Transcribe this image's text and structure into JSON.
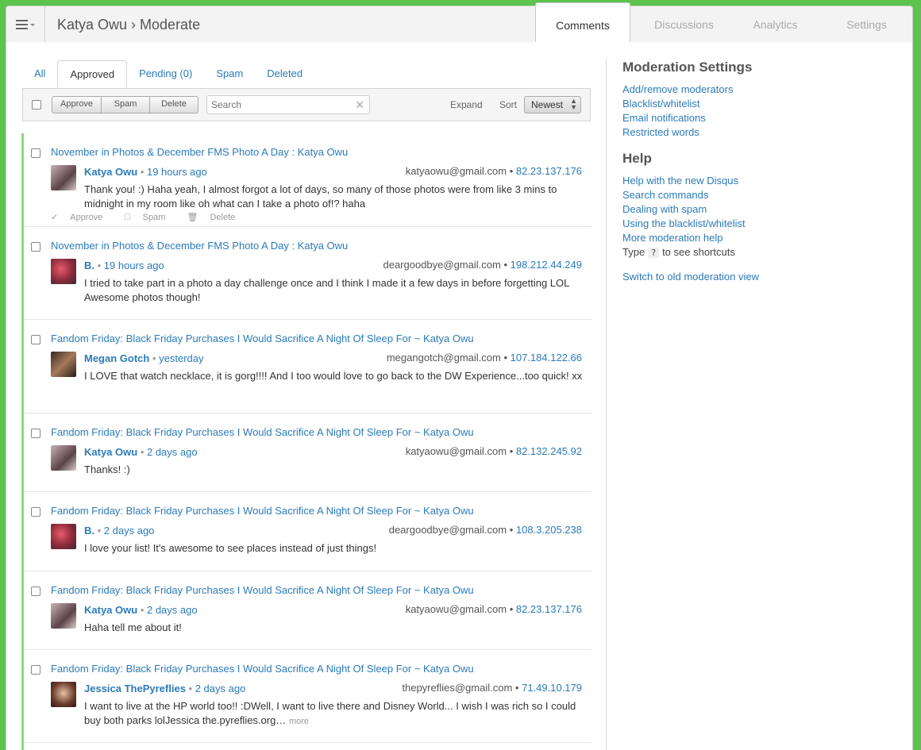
{
  "header": {
    "title": "Katya Owu › Moderate",
    "tabs": [
      {
        "label": "Comments",
        "active": true
      },
      {
        "label": "Discussions",
        "active": false
      },
      {
        "label": "Analytics",
        "active": false
      },
      {
        "label": "Settings",
        "active": false
      }
    ]
  },
  "subtabs": [
    "All",
    "Approved",
    "Pending (0)",
    "Spam",
    "Deleted"
  ],
  "toolbar": {
    "approve": "Approve",
    "spam": "Spam",
    "delete": "Delete",
    "search_placeholder": "Search",
    "expand": "Expand",
    "sort_label": "Sort",
    "sort_value": "Newest"
  },
  "actions": {
    "approve": "Approve",
    "spam": "Spam",
    "delete": "Delete"
  },
  "comments": [
    {
      "thread": "November in Photos & December FMS Photo A Day : Katya Owu",
      "author": "Katya Owu",
      "time": "19 hours ago",
      "email": "katyaowu@gmail.com",
      "ip": "82.23.137.176",
      "body": "Thank you! :) Haha yeah, I almost forgot a lot of days, so many of those photos were from like 3 mins to midnight in my room like oh what can I take a photo of!? haha",
      "more": ""
    },
    {
      "thread": "November in Photos & December FMS Photo A Day : Katya Owu",
      "author": "B.",
      "time": "19 hours ago",
      "email": "deargoodbye@gmail.com",
      "ip": "198.212.44.249",
      "body": "I tried to take part in a photo a day challenge once and I think I made it a few days in before forgetting LOL Awesome photos though!",
      "more": ""
    },
    {
      "thread": "Fandom Friday: Black Friday Purchases I Would Sacrifice A Night Of Sleep For ~ Katya Owu",
      "author": "Megan Gotch",
      "time": "yesterday",
      "email": "megangotch@gmail.com",
      "ip": "107.184.122.66",
      "body": "I LOVE that watch necklace, it is gorg!!!! And I too would love to go back to the DW Experience...too quick! xx",
      "more": ""
    },
    {
      "thread": "Fandom Friday: Black Friday Purchases I Would Sacrifice A Night Of Sleep For ~ Katya Owu",
      "author": "Katya Owu",
      "time": "2 days ago",
      "email": "katyaowu@gmail.com",
      "ip": "82.132.245.92",
      "body": "Thanks! :)",
      "more": ""
    },
    {
      "thread": "Fandom Friday: Black Friday Purchases I Would Sacrifice A Night Of Sleep For ~ Katya Owu",
      "author": "B.",
      "time": "2 days ago",
      "email": "deargoodbye@gmail.com",
      "ip": "108.3.205.238",
      "body": "I love your list! It's awesome to see places instead of just things!",
      "more": ""
    },
    {
      "thread": "Fandom Friday: Black Friday Purchases I Would Sacrifice A Night Of Sleep For ~ Katya Owu",
      "author": "Katya Owu",
      "time": "2 days ago",
      "email": "katyaowu@gmail.com",
      "ip": "82.23.137.176",
      "body": "Haha tell me about it!",
      "more": ""
    },
    {
      "thread": "Fandom Friday: Black Friday Purchases I Would Sacrifice A Night Of Sleep For ~ Katya Owu",
      "author": "Jessica ThePyreflies",
      "time": "2 days ago",
      "email": "thepyreflies@gmail.com",
      "ip": "71.49.10.179",
      "body": "I want to live at the HP world too!! :DWell, I want to live there and Disney World... I wish I was rich so I could buy both parks lolJessica the.pyreflies.org…",
      "more": "more"
    }
  ],
  "sidebar": {
    "settings_heading": "Moderation Settings",
    "settings_links": [
      "Add/remove moderators",
      "Blacklist/whitelist",
      "Email notifications",
      "Restricted words"
    ],
    "help_heading": "Help",
    "help_links": [
      "Help with the new Disqus",
      "Search commands",
      "Dealing with spam",
      "Using the blacklist/whitelist",
      "More moderation help"
    ],
    "shortcut_prefix": "Type",
    "shortcut_key": "?",
    "shortcut_suffix": "to see shortcuts",
    "old_view": "Switch to old moderation view"
  },
  "colors": {
    "accent": "#5cc44d",
    "link": "#2b7bb9",
    "approved_bar": "#8cd97a"
  }
}
